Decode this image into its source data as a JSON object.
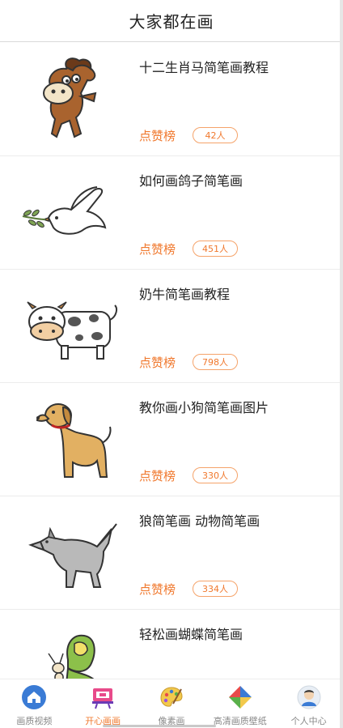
{
  "header": {
    "title": "大家都在画"
  },
  "like_label": "点赞榜",
  "items": [
    {
      "title": "十二生肖马简笔画教程",
      "likes": "42人",
      "image": "horse-cartoon"
    },
    {
      "title": "如何画鸽子简笔画",
      "likes": "451人",
      "image": "dove-with-olive-branch"
    },
    {
      "title": "奶牛简笔画教程",
      "likes": "798人",
      "image": "cow-cartoon"
    },
    {
      "title": "教你画小狗简笔画图片",
      "likes": "330人",
      "image": "dog-cartoon"
    },
    {
      "title": "狼简笔画 动物简笔画",
      "likes": "334人",
      "image": "wolf-cartoon"
    },
    {
      "title": "轻松画蝴蝶简笔画",
      "likes": "",
      "image": "butterfly-cartoon"
    }
  ],
  "tabs": [
    {
      "label": "画质视频",
      "icon": "home-icon",
      "active": false
    },
    {
      "label": "开心画画",
      "icon": "easel-icon",
      "active": true
    },
    {
      "label": "像素画",
      "icon": "palette-icon",
      "active": false
    },
    {
      "label": "高清画质壁纸",
      "icon": "pinwheel-icon",
      "active": false
    },
    {
      "label": "个人中心",
      "icon": "avatar-icon",
      "active": false
    }
  ],
  "colors": {
    "accent": "#f0782d",
    "tab_inactive": "#888888"
  }
}
